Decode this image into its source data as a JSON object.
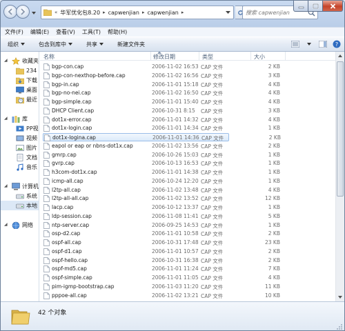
{
  "titlebar": {
    "breadcrumbs": [
      "华军优化包8.20",
      "capwenjian",
      "capwenjian"
    ],
    "search_placeholder": "搜索 capwenjian"
  },
  "menubar": {
    "items": [
      "文件(F)",
      "编辑(E)",
      "查看(V)",
      "工具(T)",
      "帮助(H)"
    ]
  },
  "toolbar": {
    "organize": "组织",
    "include_in_library": "包含到库中",
    "share": "共享",
    "new_folder": "新建文件夹"
  },
  "navpane": {
    "items": [
      {
        "label": "收藏夹",
        "icon": "star-icon"
      },
      {
        "label": "234",
        "icon": "folder-icon"
      },
      {
        "label": "下载",
        "icon": "download-icon"
      },
      {
        "label": "桌面",
        "icon": "desktop-icon"
      },
      {
        "label": "最近",
        "icon": "recent-places-icon"
      },
      {
        "label": "库",
        "icon": "library-icon"
      },
      {
        "label": "PP视",
        "icon": "video-library-icon"
      },
      {
        "label": "视频",
        "icon": "video-icon"
      },
      {
        "label": "图片",
        "icon": "pictures-icon"
      },
      {
        "label": "文档",
        "icon": "documents-icon"
      },
      {
        "label": "音乐",
        "icon": "music-icon"
      },
      {
        "label": "计算机",
        "icon": "computer-icon"
      },
      {
        "label": "系统",
        "icon": "drive-icon"
      },
      {
        "label": "本地",
        "icon": "drive-icon"
      },
      {
        "label": "网络",
        "icon": "network-icon"
      }
    ]
  },
  "columns": {
    "name": "名称",
    "date": "修改日期",
    "type": "类型",
    "size": "大小"
  },
  "files": [
    {
      "name": "bgp-con.cap",
      "date": "2006-11-02 16:53",
      "type": "CAP 文件",
      "size": "2 KB"
    },
    {
      "name": "bgp-con-nexthop-before.cap",
      "date": "2006-11-02 16:56",
      "type": "CAP 文件",
      "size": "3 KB"
    },
    {
      "name": "bgp-in.cap",
      "date": "2006-11-01 15:18",
      "type": "CAP 文件",
      "size": "4 KB"
    },
    {
      "name": "bgp-no-nei.cap",
      "date": "2006-11-02 16:50",
      "type": "CAP 文件",
      "size": "4 KB"
    },
    {
      "name": "bgp-simple.cap",
      "date": "2006-11-01 15:40",
      "type": "CAP 文件",
      "size": "4 KB"
    },
    {
      "name": "DHCP Client.cap",
      "date": "2006-10-31 8:15",
      "type": "CAP 文件",
      "size": "3 KB"
    },
    {
      "name": "dot1x-error.cap",
      "date": "2006-11-01 14:32",
      "type": "CAP 文件",
      "size": "4 KB"
    },
    {
      "name": "dot1x-login.cap",
      "date": "2006-11-01 14:34",
      "type": "CAP 文件",
      "size": "1 KB"
    },
    {
      "name": "dot1x-logina.cap",
      "date": "2006-11-01 14:36",
      "type": "CAP 文件",
      "size": "2 KB"
    },
    {
      "name": "eapol or eap or nbns-dot1x.cap",
      "date": "2006-11-02 13:56",
      "type": "CAP 文件",
      "size": "2 KB"
    },
    {
      "name": "gmrp.cap",
      "date": "2006-10-26 15:03",
      "type": "CAP 文件",
      "size": "1 KB"
    },
    {
      "name": "gvrp.cap",
      "date": "2006-10-13 16:53",
      "type": "CAP 文件",
      "size": "1 KB"
    },
    {
      "name": "h3com-dot1x.cap",
      "date": "2006-11-01 14:38",
      "type": "CAP 文件",
      "size": "1 KB"
    },
    {
      "name": "icmp-all.cap",
      "date": "2006-10-24 12:20",
      "type": "CAP 文件",
      "size": "1 KB"
    },
    {
      "name": "l2tp-all.cap",
      "date": "2006-11-02 13:48",
      "type": "CAP 文件",
      "size": "4 KB"
    },
    {
      "name": "l2tp-all-all.cap",
      "date": "2006-11-02 13:52",
      "type": "CAP 文件",
      "size": "12 KB"
    },
    {
      "name": "lacp.cap",
      "date": "2006-10-12 13:37",
      "type": "CAP 文件",
      "size": "1 KB"
    },
    {
      "name": "ldp-session.cap",
      "date": "2006-11-08 11:41",
      "type": "CAP 文件",
      "size": "5 KB"
    },
    {
      "name": "ntp-server.cap",
      "date": "2006-09-25 14:53",
      "type": "CAP 文件",
      "size": "1 KB"
    },
    {
      "name": "osp-d2.cap",
      "date": "2006-11-01 10:58",
      "type": "CAP 文件",
      "size": "2 KB"
    },
    {
      "name": "ospf-all.cap",
      "date": "2006-10-31 17:48",
      "type": "CAP 文件",
      "size": "23 KB"
    },
    {
      "name": "ospf-d1.cap",
      "date": "2006-11-01 10:57",
      "type": "CAP 文件",
      "size": "2 KB"
    },
    {
      "name": "ospf-hello.cap",
      "date": "2006-10-31 16:38",
      "type": "CAP 文件",
      "size": "2 KB"
    },
    {
      "name": "ospf-md5.cap",
      "date": "2006-11-01 11:24",
      "type": "CAP 文件",
      "size": "7 KB"
    },
    {
      "name": "ospf-simple.cap",
      "date": "2006-11-01 11:05",
      "type": "CAP 文件",
      "size": "4 KB"
    },
    {
      "name": "pim-igmp-bootstrap.cap",
      "date": "2006-11-03 11:20",
      "type": "CAP 文件",
      "size": "11 KB"
    },
    {
      "name": "pppoe-all.cap",
      "date": "2006-11-02 13:21",
      "type": "CAP 文件",
      "size": "10 KB"
    }
  ],
  "selected_file": "dot1x-logina.cap",
  "details": {
    "count": "42 个对象"
  },
  "colors": {
    "accent": "#99bde8",
    "selection_bg": "#dbeafa",
    "frame": "#b9cde8",
    "close_button": "#c5442a"
  }
}
